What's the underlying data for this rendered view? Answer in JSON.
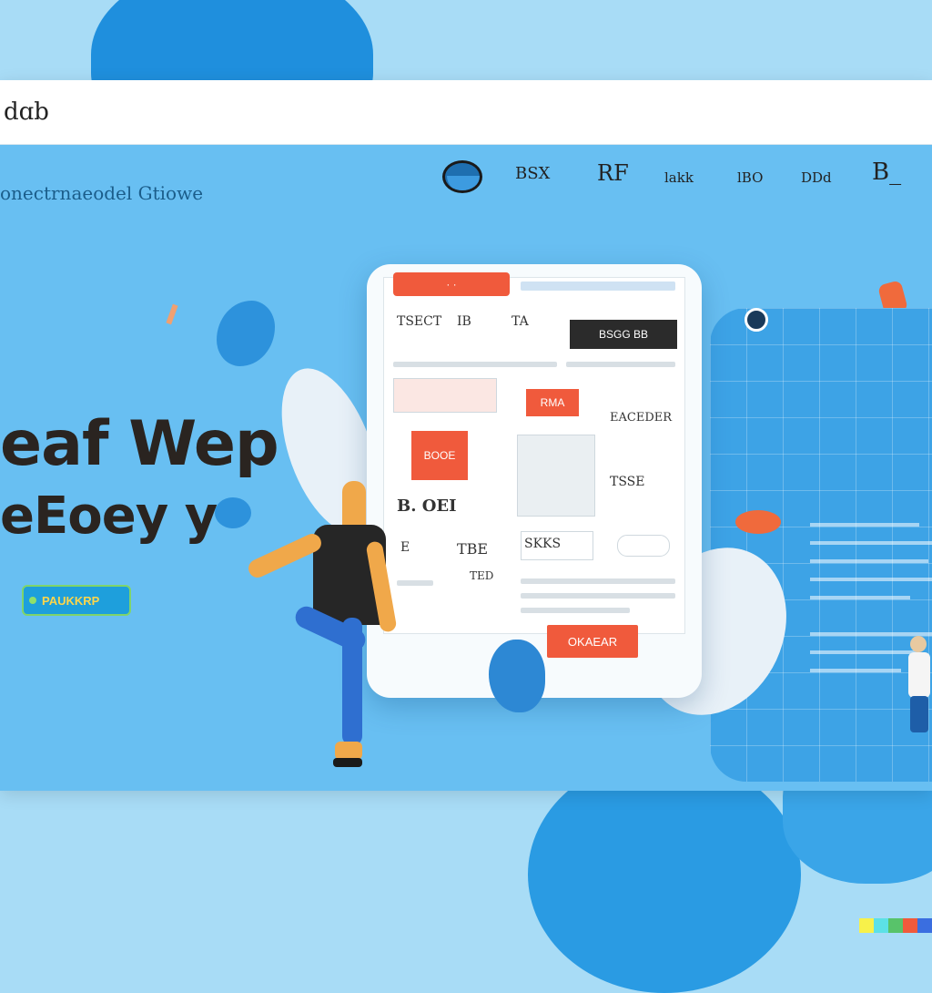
{
  "browser": {
    "address_text": "dɑb"
  },
  "header": {
    "brand": "onectrnaeodel Gtiowe",
    "nav": [
      {
        "label": "BSX"
      },
      {
        "label": "RF"
      },
      {
        "label": "lakk"
      },
      {
        "label": "lBO"
      },
      {
        "label": "DDd"
      },
      {
        "label": "B_"
      }
    ]
  },
  "hero": {
    "title_line1": "eaf Wep",
    "title_line2": "eEoey y",
    "button_label": "PAUKKRP"
  },
  "mockup": {
    "top_tab": "· ·",
    "row1": [
      "TSECT",
      "IB",
      "TA"
    ],
    "dark_tag": "BSGG BB",
    "red_small": "RMA",
    "right_label": "EACEDER",
    "red_block": "BOOE",
    "label_b": "B. OEI",
    "label_ts": "TSSE",
    "label_e": "E",
    "label_tk": "TBE",
    "label_ted": "TED",
    "label_sk": "SKKS",
    "bottom_button": "OKAEAR"
  },
  "colors": {
    "accent_blue": "#68bff2",
    "accent_red": "#f05a3c",
    "dark_text": "#2a2420"
  },
  "icons": {
    "avatar": "avatar-icon"
  }
}
